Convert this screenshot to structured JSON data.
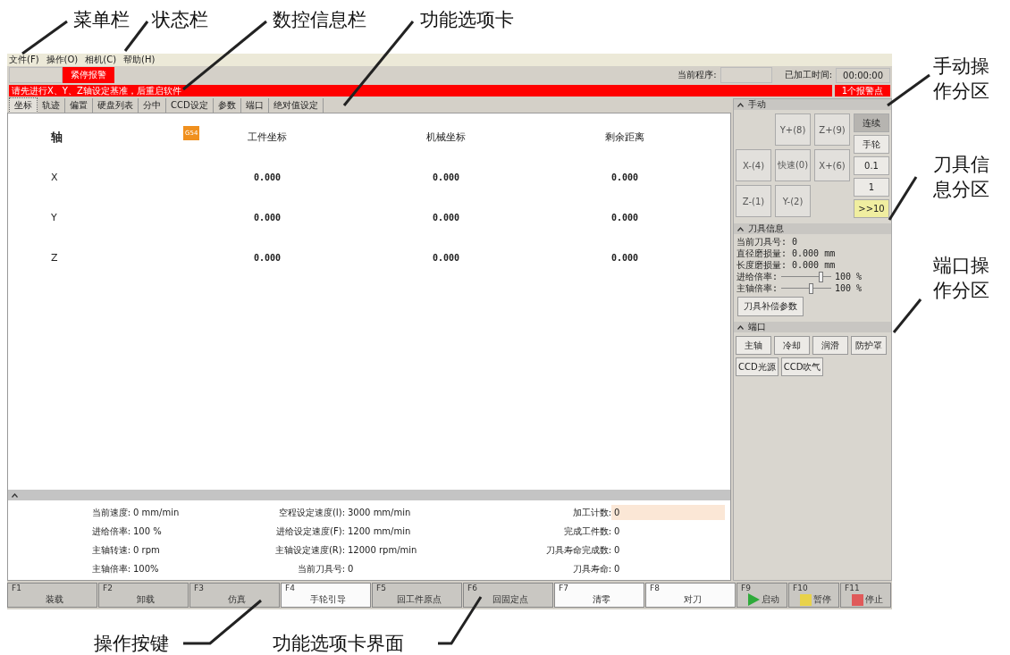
{
  "annotations": {
    "top": [
      {
        "label": "菜单栏"
      },
      {
        "label": "状态栏"
      },
      {
        "label": "数控信息栏"
      },
      {
        "label": "功能选项卡"
      }
    ],
    "right": [
      {
        "label": "手动操作分区"
      },
      {
        "label": "刀具信息分区"
      },
      {
        "label": "端口操作分区"
      }
    ],
    "bottom": [
      {
        "label": "操作按键"
      },
      {
        "label": "功能选项卡界面"
      }
    ]
  },
  "menu": [
    "文件(F)",
    "操作(O)",
    "相机(C)",
    "帮助(H)"
  ],
  "status_bar": {
    "alarm": "紧停报警",
    "program_label": "当前程序:",
    "time_label": "已加工时间:",
    "time": "00:00:00"
  },
  "info_bar": {
    "message": "请先进行X、Y、Z轴设定基准，后重启软件",
    "alarm_count": "1个报警点"
  },
  "tabs": [
    {
      "label": "坐标",
      "selected": true
    },
    {
      "label": "轨迹",
      "selected": false
    },
    {
      "label": "偏置",
      "selected": false
    },
    {
      "label": "硬盘列表",
      "selected": false
    },
    {
      "label": "分中",
      "selected": false
    },
    {
      "label": "CCD设定",
      "selected": false
    },
    {
      "label": "参数",
      "selected": false
    },
    {
      "label": "端口",
      "selected": false
    },
    {
      "label": "绝对值设定",
      "selected": false
    }
  ],
  "table": {
    "columns": [
      "轴",
      "工件坐标",
      "机械坐标",
      "剩余距离"
    ],
    "badge": "G54",
    "rows": [
      [
        "X",
        "0.000",
        "0.000",
        "0.000"
      ],
      [
        "Y",
        "0.000",
        "0.000",
        "0.000"
      ],
      [
        "Z",
        "0.000",
        "0.000",
        "0.000"
      ]
    ]
  },
  "info": [
    [
      {
        "label": "当前速度:",
        "value": "0 mm/min",
        "kind": "text"
      },
      {
        "label": "进给倍率:",
        "value": "100 %",
        "kind": "text"
      },
      {
        "label": "主轴转速:",
        "value": "0 rpm",
        "kind": "text"
      },
      {
        "label": "主轴倍率:",
        "value": "100%",
        "kind": "text"
      }
    ],
    [
      {
        "label": "空程设定速度(I):",
        "value": "3000 mm/min",
        "kind": "text"
      },
      {
        "label": "进给设定速度(F):",
        "value": "1200 mm/min",
        "kind": "text"
      },
      {
        "label": "主轴设定速度(R):",
        "value": "12000 rpm/min",
        "kind": "text"
      },
      {
        "label": "当前刀具号:",
        "value": "0",
        "kind": "text"
      }
    ],
    [
      {
        "label": "加工计数:",
        "value": "0",
        "kind": "field"
      },
      {
        "label": "完成工件数:",
        "value": "0",
        "kind": "text"
      },
      {
        "label": "刀具寿命完成数:",
        "value": "0",
        "kind": "text"
      },
      {
        "label": "刀具寿命:",
        "value": "0",
        "kind": "text"
      }
    ]
  ],
  "manual": {
    "title": "手动",
    "jog": [
      "Y+(8)",
      "Z+(9)",
      "X-(4)",
      "快速(0)",
      "X+(6)",
      "Z-(1)",
      "Y-(2)"
    ],
    "modes": [
      {
        "label": "连续",
        "selected": true
      },
      {
        "label": "手轮",
        "selected": false
      }
    ],
    "steps": [
      {
        "label": "0.1",
        "selected": false
      },
      {
        "label": "1",
        "selected": false
      },
      {
        "label": ">>10",
        "selected": true
      }
    ]
  },
  "tool": {
    "title": "刀具信息",
    "number": "当前刀具号: 0",
    "diameter": "直径磨损量: 0.000 mm",
    "length": "长度磨损量: 0.000 mm",
    "sliders": [
      {
        "label": "进给倍率:",
        "level": 0.8,
        "reading": "100 %"
      },
      {
        "label": "主轴倍率:",
        "level": 0.6,
        "reading": "100 %"
      }
    ],
    "button": "刀具补偿参数"
  },
  "ports": {
    "title": "端口",
    "buttons": [
      "主轴",
      "冷却",
      "润滑",
      "防护罩",
      "CCD光源",
      "CCD吹气"
    ]
  },
  "keys": [
    {
      "key": "F1",
      "label": "装载",
      "kind": "plain",
      "highlighted": false
    },
    {
      "key": "F2",
      "label": "卸载",
      "kind": "plain",
      "highlighted": false
    },
    {
      "key": "F3",
      "label": "仿真",
      "kind": "plain",
      "highlighted": false
    },
    {
      "key": "F4",
      "label": "手轮引导",
      "kind": "plain",
      "highlighted": true
    },
    {
      "key": "F5",
      "label": "回工件原点",
      "kind": "plain",
      "highlighted": false
    },
    {
      "key": "F6",
      "label": "回固定点",
      "kind": "plain",
      "highlighted": false
    },
    {
      "key": "F7",
      "label": "清零",
      "kind": "plain",
      "highlighted": true
    },
    {
      "key": "F8",
      "label": "对刀",
      "kind": "plain",
      "highlighted": true
    },
    {
      "key": "F9",
      "label": "启动",
      "kind": "start",
      "highlighted": false
    },
    {
      "key": "F10",
      "label": "暂停",
      "kind": "pause",
      "highlighted": false
    },
    {
      "key": "F11",
      "label": "停止",
      "kind": "stop",
      "highlighted": false
    }
  ]
}
